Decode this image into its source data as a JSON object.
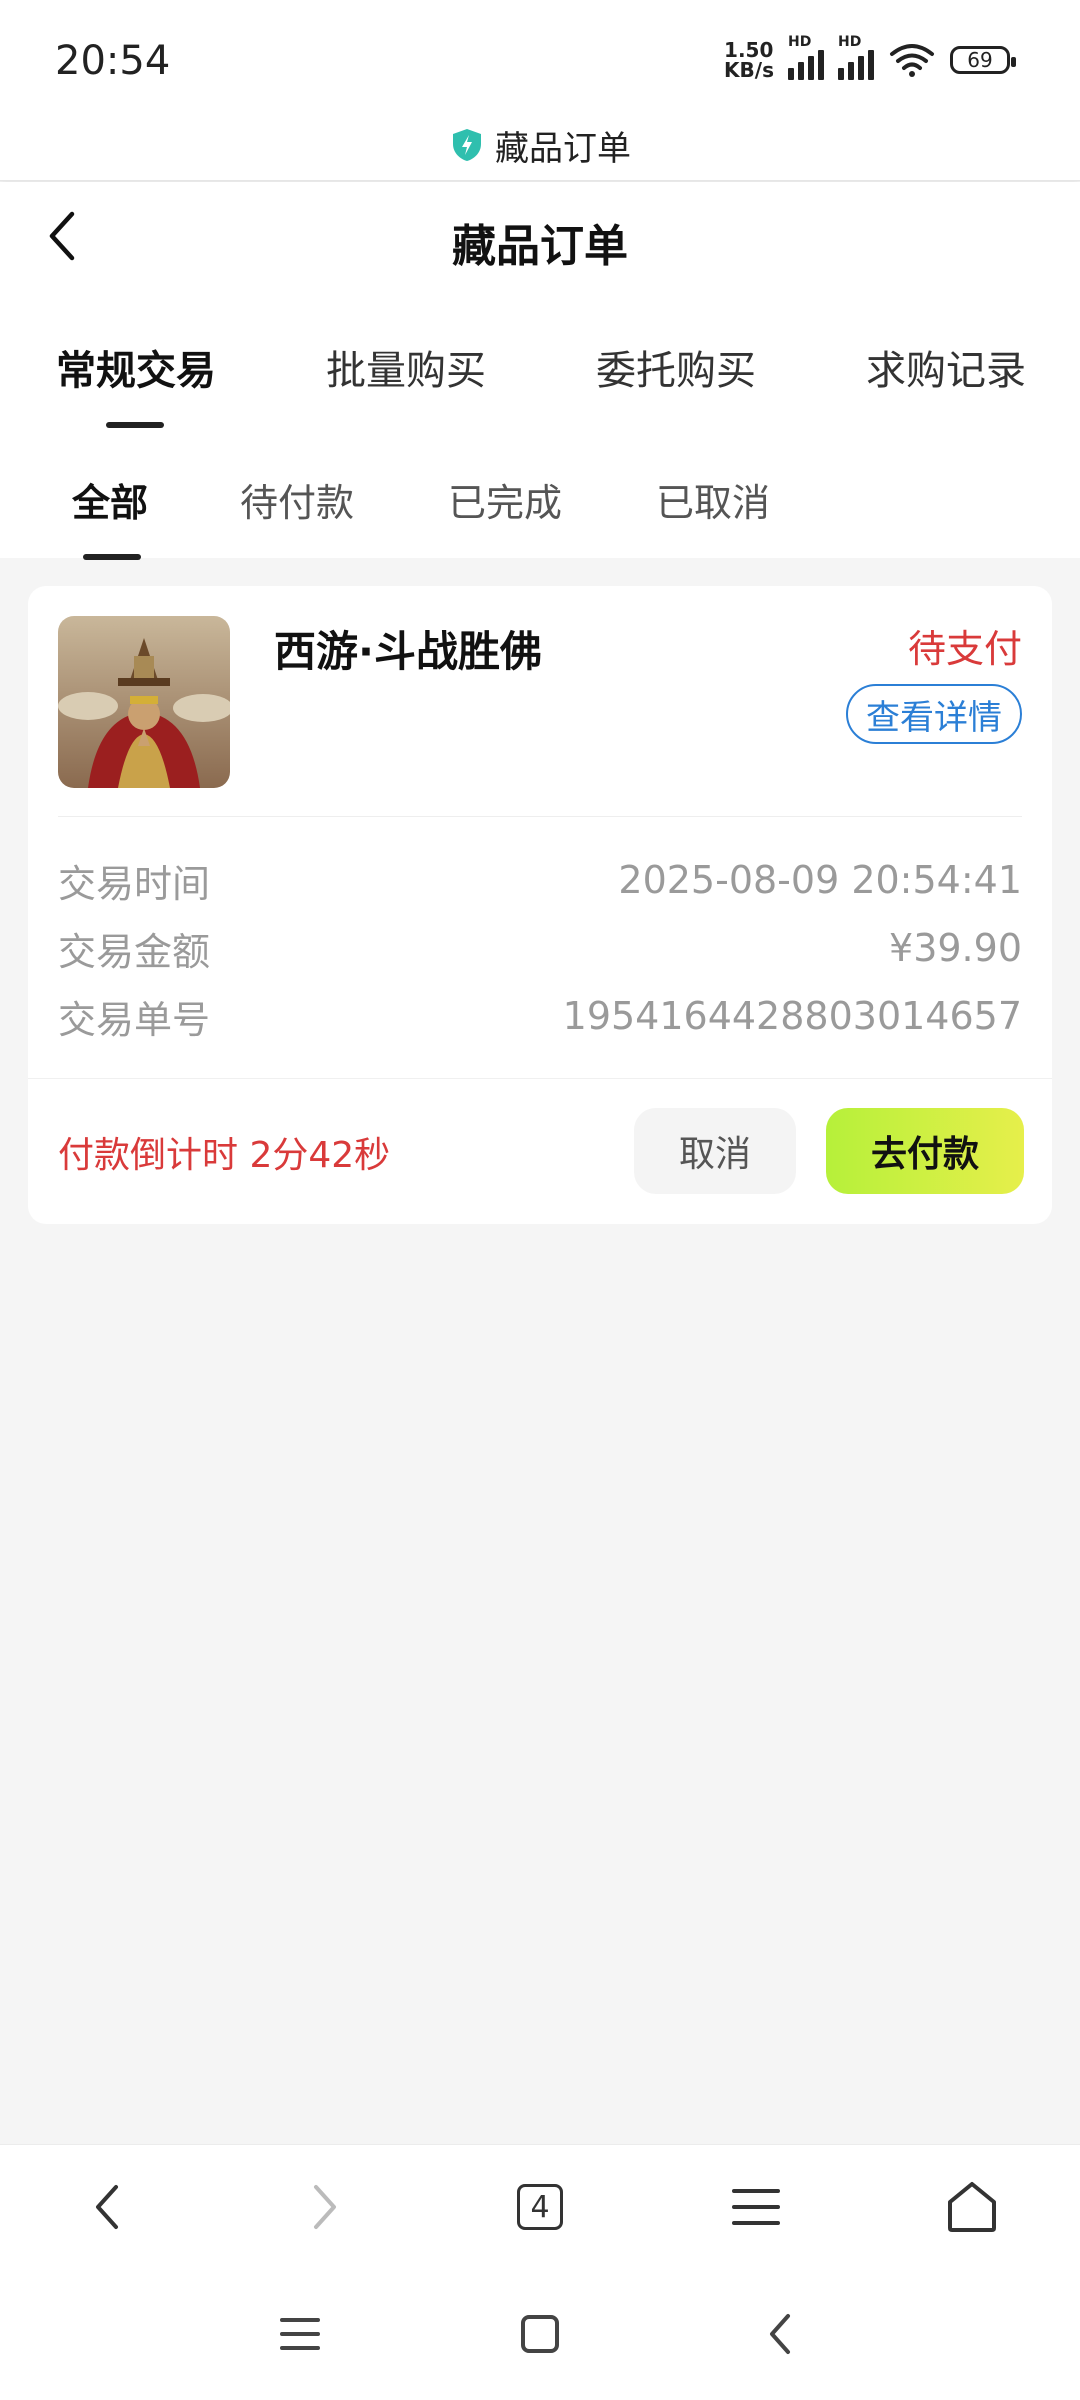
{
  "status_bar": {
    "time": "20:54",
    "net_speed_value": "1.50",
    "net_speed_unit": "KB/s",
    "hd_label": "HD",
    "battery_level": "69"
  },
  "app_bar": {
    "title": "藏品订单"
  },
  "header": {
    "title": "藏品订单"
  },
  "primary_tabs": [
    {
      "label": "常规交易",
      "active": true
    },
    {
      "label": "批量购买",
      "active": false
    },
    {
      "label": "委托购买",
      "active": false
    },
    {
      "label": "求购记录",
      "active": false
    }
  ],
  "secondary_tabs": [
    {
      "label": "全部",
      "active": true
    },
    {
      "label": "待付款",
      "active": false
    },
    {
      "label": "已完成",
      "active": false
    },
    {
      "label": "已取消",
      "active": false
    }
  ],
  "order": {
    "item_title": "西游·斗战胜佛",
    "status": "待支付",
    "detail_button": "查看详情",
    "info": [
      {
        "label": "交易时间",
        "value": "2025-08-09 20:54:41"
      },
      {
        "label": "交易金额",
        "value": "¥39.90"
      },
      {
        "label": "交易单号",
        "value": "1954164428803014657"
      }
    ],
    "countdown": "付款倒计时 2分42秒",
    "cancel_button": "取消",
    "pay_button": "去付款"
  },
  "browser_bar": {
    "tab_count": "4"
  },
  "colors": {
    "status_red": "#d93a3a",
    "detail_blue": "#2b7fd6",
    "pay_green_start": "#b6f03a",
    "pay_green_end": "#e6ef4b"
  }
}
